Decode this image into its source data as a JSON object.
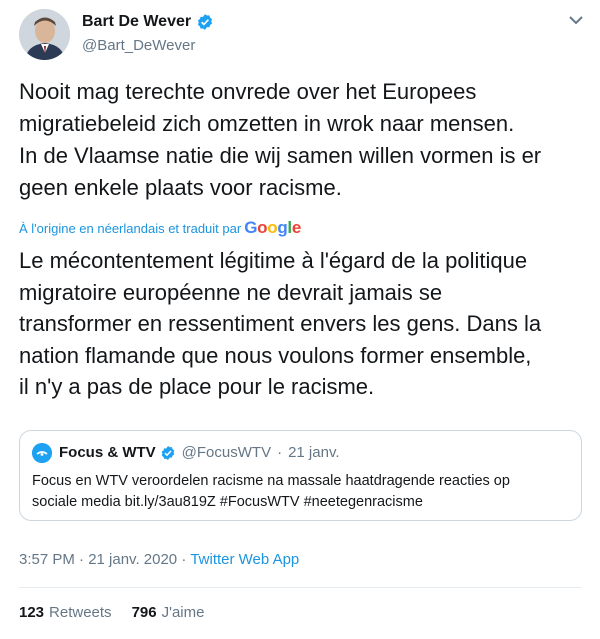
{
  "author": {
    "name": "Bart De Wever",
    "handle": "@Bart_DeWever"
  },
  "tweet_text": "Nooit mag terechte onvrede over het Europees\nmigratiebeleid zich omzetten in wrok naar mensen.\nIn de Vlaamse natie die wij samen willen vormen is er\ngeen enkele plaats voor racisme.",
  "translation": {
    "label": "À l'origine en néerlandais et traduit par",
    "provider_letters": [
      "G",
      "o",
      "o",
      "g",
      "l",
      "e"
    ],
    "text": "Le mécontentement légitime à l'égard de la politique\nmigratoire européenne ne devrait jamais se\ntransformer en ressentiment envers les gens. Dans la\nnation flamande que nous voulons former ensemble,\nil n'y a pas de place pour le racisme."
  },
  "quoted_tweet": {
    "name": "Focus & WTV",
    "handle": "@FocusWTV",
    "separator": "·",
    "date": "21 janv.",
    "text": "Focus en WTV veroordelen racisme na massale haatdragende reacties op\nsociale media bit.ly/3au819Z #FocusWTV #neetegenracisme"
  },
  "meta": {
    "timestamp": "3:57 PM · 21 janv. 2020 ·",
    "source": "Twitter Web App"
  },
  "stats": {
    "retweets_count": "123",
    "retweets_label": "Retweets",
    "likes_count": "796",
    "likes_label": "J'aime"
  },
  "colors": {
    "link": "#1b95e0",
    "verified": "#1da1f2",
    "secondary_text": "#657786"
  },
  "icons": {
    "verified": "verified-badge-icon",
    "caret": "chevron-down-icon"
  }
}
